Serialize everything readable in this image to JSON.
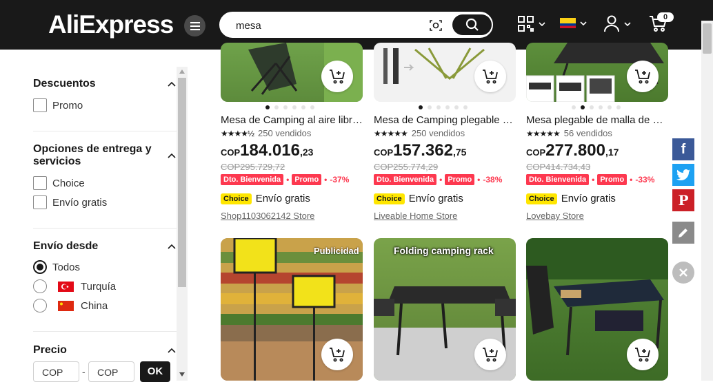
{
  "header": {
    "logo_text": "AliExpress",
    "search_value": "mesa",
    "cart_count": "0",
    "icons": [
      "menu-icon",
      "camera-search-icon",
      "search-icon",
      "qr-code-icon",
      "colombia-flag-icon",
      "user-icon",
      "cart-icon"
    ]
  },
  "sidebar": {
    "discounts": {
      "title": "Descuentos",
      "options": [
        "Promo"
      ]
    },
    "delivery": {
      "title": "Opciones de entrega y servicios",
      "options": [
        "Choice",
        "Envío gratis"
      ]
    },
    "ship_from": {
      "title": "Envío desde",
      "options": [
        "Todos",
        "Turquía",
        "China"
      ],
      "selected": "Todos"
    },
    "price": {
      "title": "Precio",
      "min_placeholder": "COP",
      "max_placeholder": "COP",
      "separator": "-",
      "ok_label": "OK"
    }
  },
  "products": [
    {
      "title": "Mesa de Camping al aire libre...",
      "sold": "250 vendidos",
      "rating": 4.5,
      "currency": "COP",
      "price_int": "184.016",
      "price_dec": ",23",
      "old_price": "COP295.729,72",
      "badges": [
        "Dto. Bienvenida",
        "Promo"
      ],
      "discount": "-37%",
      "choice": "Choice",
      "shipping": "Envío gratis",
      "store": "Shop1103062142 Store"
    },
    {
      "title": "Mesa de Camping plegable p...",
      "sold": "250 vendidos",
      "rating": 5,
      "currency": "COP",
      "price_int": "157.362",
      "price_dec": ",75",
      "old_price": "COP255.774,29",
      "badges": [
        "Dto. Bienvenida",
        "Promo"
      ],
      "discount": "-38%",
      "choice": "Choice",
      "shipping": "Envío gratis",
      "store": "Liveable Home Store"
    },
    {
      "title": "Mesa plegable de malla de hi...",
      "sold": "56 vendidos",
      "rating": 5,
      "currency": "COP",
      "price_int": "277.800",
      "price_dec": ",17",
      "old_price": "COP414.734,43",
      "badges": [
        "Dto. Bienvenida",
        "Promo"
      ],
      "discount": "-33%",
      "choice": "Choice",
      "shipping": "Envío gratis",
      "store": "Lovebay Store"
    }
  ],
  "row2": {
    "ad_label": "Publicidad",
    "caption_2": "Folding camping rack"
  },
  "social": [
    "facebook-icon",
    "twitter-icon",
    "pinterest-icon",
    "edit-icon",
    "close-icon"
  ],
  "colors": {
    "header_bg": "#191919",
    "discount_red": "#fd384f",
    "choice_yellow": "#ffe600",
    "facebook": "#3b5998",
    "twitter": "#1da1f2",
    "pinterest": "#cb2027"
  }
}
